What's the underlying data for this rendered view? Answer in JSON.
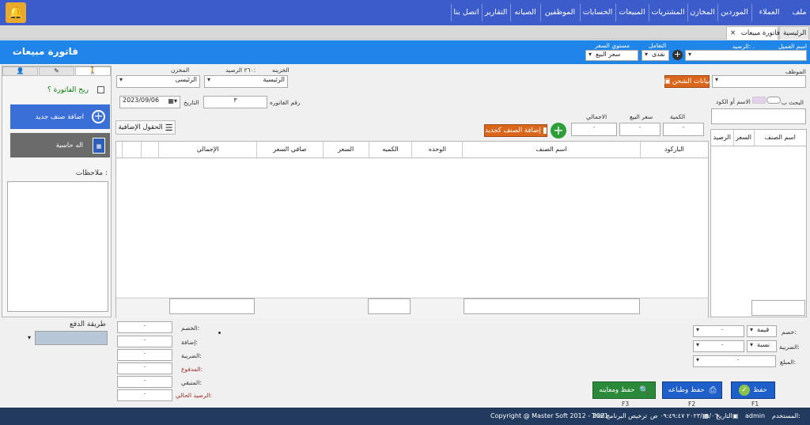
{
  "menu": {
    "items": [
      "ملف",
      "العملاء",
      "الموردين",
      "المخازن",
      "المشتريات",
      "المبيعات",
      "الحسابات",
      "الموظفين",
      "الصيانه",
      "التقارير",
      "اتصل بنا"
    ]
  },
  "tabs": [
    {
      "label": "الرئيسية"
    },
    {
      "label": "فاتورة مبيعات",
      "close": "×"
    }
  ],
  "header": {
    "title": "فاتورة مبيعات",
    "customer_name_label": "اسم العميل",
    "balance_label": "الرصيد:",
    "balance_value": ".",
    "dealing_label": "التعامل",
    "dealing_value": "نقدى",
    "price_level_label": "مستوي السعر",
    "price_level_value": "سعر البيع"
  },
  "form": {
    "employee_label": "الموظف",
    "shipping_button": "بيانات الشحن",
    "store_label": "المخزن",
    "store_value": "الرئيسى",
    "treasury_label": "الخزينه",
    "treasury_balance_label": "الرصيد:",
    "treasury_balance_value": "٢٦٠",
    "treasury_value": "الرئيسية",
    "invoice_no_label": "رقم الفاتوره",
    "invoice_no_value": "٣",
    "date_label": "التاريخ",
    "date_value": "2023/09/06",
    "search_label": "البحث ب",
    "search_by_label": "الاسم أو الكود",
    "qty_label": "الكمية",
    "qty_value": "٠",
    "sale_price_label": "سعر البيع",
    "sale_price_value": "٠",
    "total_label": "الاجمالي",
    "total_value": "٠",
    "add_as_new_label": "إضافة الصنف كجديد",
    "extra_fields_label": "الحقول الإضافية"
  },
  "grid": {
    "columns": [
      "الباركود",
      "اسم الصنف",
      "الوحده",
      "الكميه",
      "السعر",
      "صافي السعر",
      "الإجمالي"
    ]
  },
  "item_list": {
    "columns": [
      "اسم الصنف",
      "السعر",
      "الرصيد"
    ]
  },
  "right_panel": {
    "profit_label": "ربح الفاتورة ؟",
    "add_new_item": "اضافة صنف جديد",
    "calculator": "اله حاسبة",
    "notes_label": "ملاحظات :",
    "payment_method_label": "طريقة الدفع"
  },
  "totals": {
    "discount_label": "الخصم:",
    "discount_value": "٠",
    "addition_label": "إضافة:",
    "addition_value": "٠",
    "tax_label": "الضريبة:",
    "tax_value": "٠",
    "paid_label": "المدفوع:",
    "paid_value": "٠",
    "remaining_label": "المتبقي:",
    "remaining_value": "٠",
    "current_balance_label": "الرصيد الحالي:",
    "current_balance_value": "٠"
  },
  "adjust": {
    "discount_label": "خصم:",
    "discount_type": "قيمة",
    "discount_value": "٠",
    "tax_label": "الضريبة:",
    "tax_type": "نسبة",
    "tax_value": "٠",
    "amount_label": "المبلغ:",
    "amount_value": "٠"
  },
  "actions": {
    "save": "حفظ",
    "save_key": "F1",
    "save_print": "حفظ وطباعه",
    "save_print_key": "F2",
    "save_preview": "حفظ ومعاينه",
    "save_preview_key": "F3"
  },
  "status": {
    "user_label": "المستخدم:",
    "user_value": "admin",
    "date_label": "التاريخ",
    "datetime_value": "٢٠٢٣/٠٩/٠٦ ٠٩:٤٩:٤٧ ص",
    "license_label": "ترخيص البرنامج",
    "license_value": "Trial",
    "copyright": "Copyright @ Master Soft 2012 - 2021"
  },
  "colors": {
    "menu_bg": "#3c5ccc",
    "header_bg": "#1f85e8",
    "accent_blue": "#3a6fd8",
    "shipping_orange": "#d9661a",
    "add_green": "#2e9e3a",
    "save_green": "#2a8a3a",
    "status_bg": "#223a5e"
  }
}
